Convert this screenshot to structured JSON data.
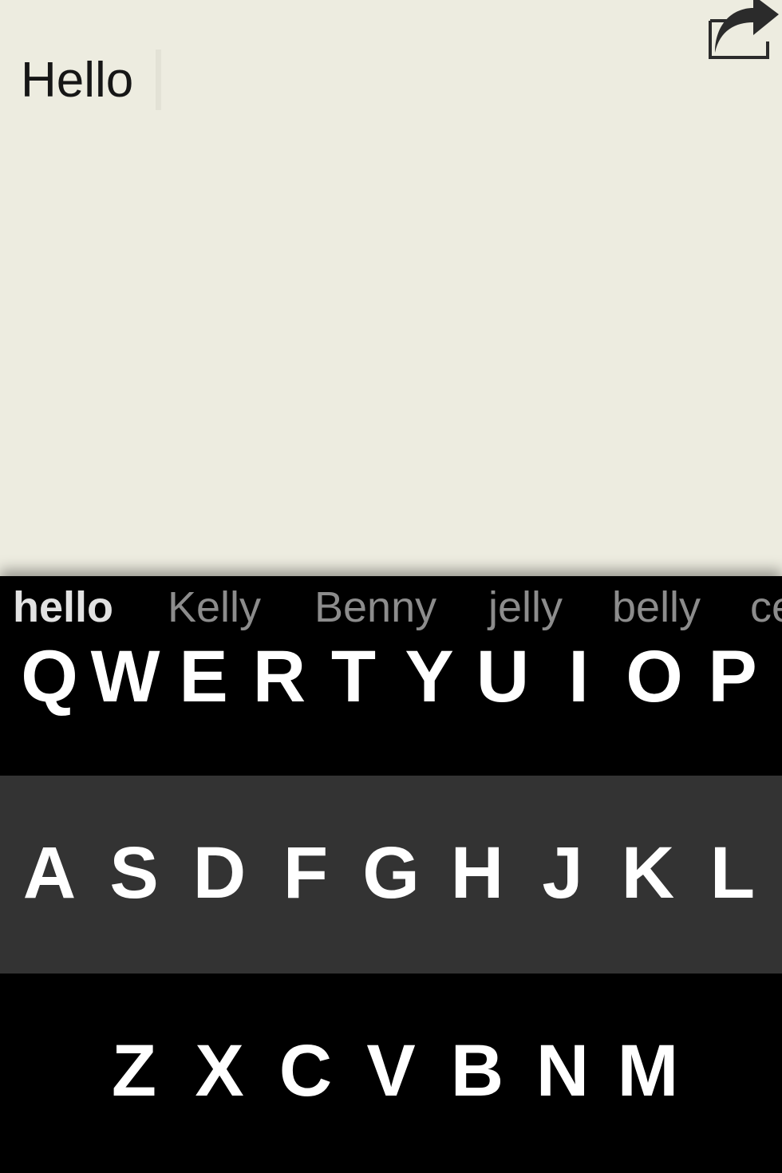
{
  "editor": {
    "text": "Hello"
  },
  "icons": {
    "share": "share-icon"
  },
  "colors": {
    "background": "#edece0",
    "keyboard": "#000000",
    "middle_row": "#333333",
    "suggestion_primary": "#e2e2e2",
    "suggestion": "#8c8c8c"
  },
  "suggestions": [
    "hello",
    "Kelly",
    "Benny",
    "jelly",
    "belly",
    "ce"
  ],
  "keys": {
    "row1": [
      "Q",
      "W",
      "E",
      "R",
      "T",
      "Y",
      "U",
      "I",
      "O",
      "P"
    ],
    "row2": [
      "A",
      "S",
      "D",
      "F",
      "G",
      "H",
      "J",
      "K",
      "L"
    ],
    "row3": [
      "Z",
      "X",
      "C",
      "V",
      "B",
      "N",
      "M"
    ]
  }
}
